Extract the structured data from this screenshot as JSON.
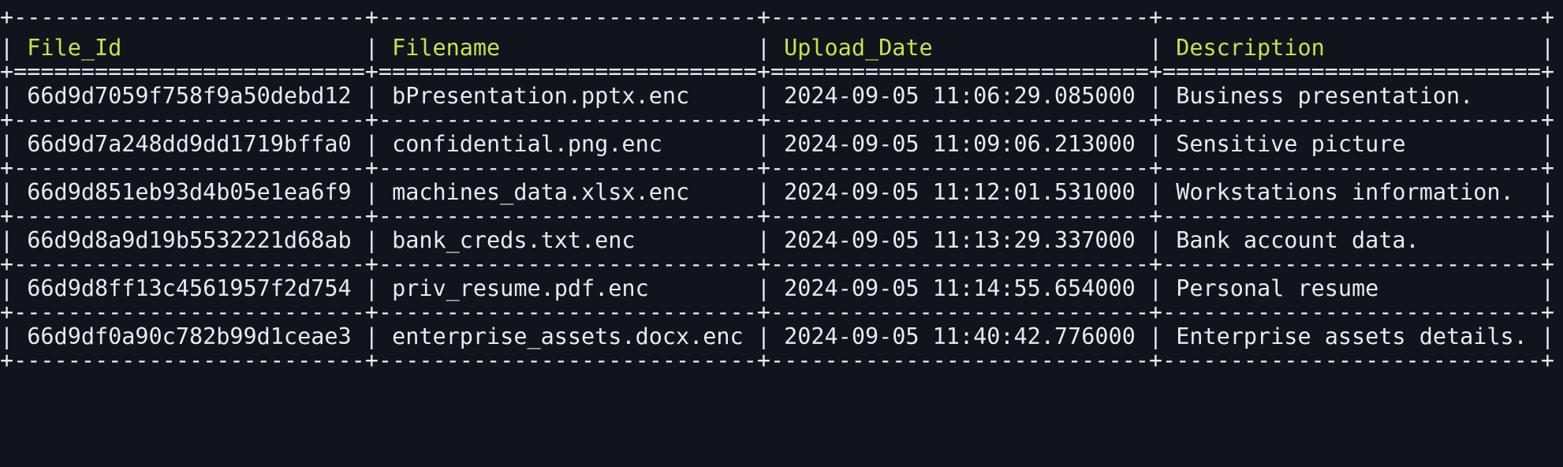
{
  "table": {
    "headers": [
      "File_Id",
      "Filename",
      "Upload_Date",
      "Description"
    ],
    "rows": [
      [
        "66d9d7059f758f9a50debd12",
        "bPresentation.pptx.enc",
        "2024-09-05 11:06:29.085000",
        "Business presentation."
      ],
      [
        "66d9d7a248dd9dd1719bffa0",
        "confidential.png.enc",
        "2024-09-05 11:09:06.213000",
        "Sensitive picture"
      ],
      [
        "66d9d851eb93d4b05e1ea6f9",
        "machines_data.xlsx.enc",
        "2024-09-05 11:12:01.531000",
        "Workstations information."
      ],
      [
        "66d9d8a9d19b5532221d68ab",
        "bank_creds.txt.enc",
        "2024-09-05 11:13:29.337000",
        "Bank account data."
      ],
      [
        "66d9d8ff13c4561957f2d754",
        "priv_resume.pdf.enc",
        "2024-09-05 11:14:55.654000",
        "Personal resume"
      ],
      [
        "66d9df0a90c782b99d1ceae3",
        "enterprise_assets.docx.enc",
        "2024-09-05 11:40:42.776000",
        "Enterprise assets details."
      ]
    ]
  },
  "colors": {
    "background": "#11141d",
    "text": "#e8eaf0",
    "header_text": "#c6e44a"
  }
}
